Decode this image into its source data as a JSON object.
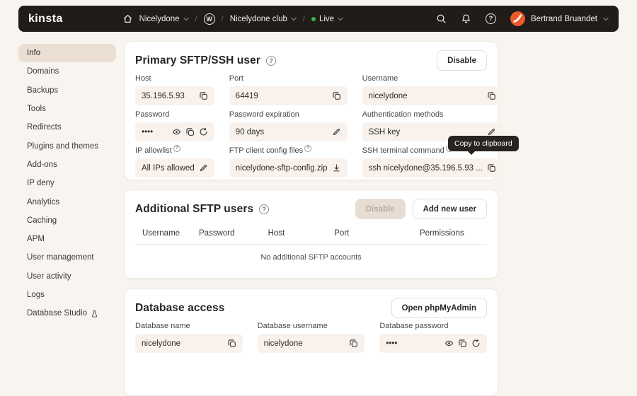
{
  "colors": {
    "header_bg": "#1f1c19",
    "page_bg": "#f8f4ef",
    "card_bg": "#ffffff",
    "field_bg": "#f9f2ec",
    "active_item_bg": "#ebdfd4",
    "live_green": "#3eb44a",
    "avatar_orange": "#ed5a29",
    "tooltip_bg": "#282420"
  },
  "icons": {
    "help_glyph": "?",
    "wordpress_glyph": "W"
  },
  "header": {
    "logo": "kinsta",
    "separator": "/",
    "breadcrumb": {
      "site": "Nicelydone",
      "club": "Nicelydone club",
      "env": "Live"
    },
    "user_name": "Bertrand Bruandet"
  },
  "sidebar": {
    "items": [
      {
        "label": "Info"
      },
      {
        "label": "Domains"
      },
      {
        "label": "Backups"
      },
      {
        "label": "Tools"
      },
      {
        "label": "Redirects"
      },
      {
        "label": "Plugins and themes"
      },
      {
        "label": "Add-ons"
      },
      {
        "label": "IP deny"
      },
      {
        "label": "Analytics"
      },
      {
        "label": "Caching"
      },
      {
        "label": "APM"
      },
      {
        "label": "User management"
      },
      {
        "label": "User activity"
      },
      {
        "label": "Logs"
      },
      {
        "label": "Database Studio"
      }
    ]
  },
  "primary": {
    "title": "Primary SFTP/SSH user",
    "disable_button": "Disable",
    "tooltip": "Copy to clipboard",
    "fields": [
      {
        "label": "Host",
        "value": "35.196.5.93"
      },
      {
        "label": "Port",
        "value": "64419"
      },
      {
        "label": "Username",
        "value": "nicelydone"
      },
      {
        "label": "Password",
        "value": "••••"
      },
      {
        "label": "Password expiration",
        "value": "90 days"
      },
      {
        "label": "Authentication methods",
        "value": "SSH key"
      },
      {
        "label": "IP allowlist",
        "value": "All IPs allowed"
      },
      {
        "label": "FTP client config files",
        "value": "nicelydone-sftp-config.zip"
      },
      {
        "label": "SSH terminal command",
        "value": "ssh nicelydone@35.196.5.93 ..."
      }
    ]
  },
  "additional": {
    "title": "Additional SFTP users",
    "disable_button": "Disable",
    "add_button": "Add new user",
    "columns": [
      "Username",
      "Password",
      "Host",
      "Port",
      "Permissions"
    ],
    "empty_message": "No additional SFTP accounts"
  },
  "database": {
    "title": "Database access",
    "open_button": "Open phpMyAdmin",
    "fields": [
      {
        "label": "Database name",
        "value": "nicelydone"
      },
      {
        "label": "Database username",
        "value": "nicelydone"
      },
      {
        "label": "Database password",
        "value": "••••"
      }
    ]
  }
}
